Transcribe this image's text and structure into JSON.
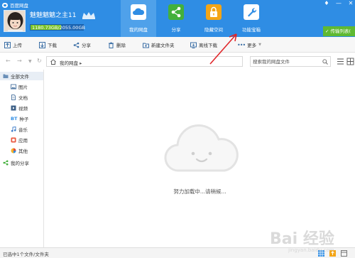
{
  "app": {
    "title": "百度网盘"
  },
  "window_controls": [
    "♦",
    "—",
    "✕"
  ],
  "user": {
    "name": "魅魅魑魑之主11",
    "quota_text": "1180.73GB/2055.00GB",
    "quota_used_fraction": 0.575
  },
  "nav": {
    "items": [
      {
        "label": "我的网盘",
        "icon": "cloud-icon"
      },
      {
        "label": "分享",
        "icon": "share-icon"
      },
      {
        "label": "隐藏空间",
        "icon": "lock-icon"
      },
      {
        "label": "功能宝箱",
        "icon": "wrench-icon"
      }
    ],
    "active_index": 0
  },
  "transfer_button": "传输列表(",
  "toolbar": {
    "upload": "上传",
    "download": "下载",
    "share": "分享",
    "delete": "删除",
    "new_folder": "新建文件夹",
    "offline_download": "离线下载",
    "more": "更多"
  },
  "address": {
    "path": "我的网盘",
    "separator": "▸"
  },
  "search": {
    "placeholder": "搜索我的网盘文件"
  },
  "sidebar": {
    "items": [
      {
        "label": "全部文件",
        "icon": "folder-icon"
      },
      {
        "label": "图片",
        "icon": "image-icon"
      },
      {
        "label": "文档",
        "icon": "document-icon"
      },
      {
        "label": "视频",
        "icon": "video-icon"
      },
      {
        "label": "种子",
        "icon": "bt-icon",
        "icon_text": "BT"
      },
      {
        "label": "音乐",
        "icon": "music-icon"
      },
      {
        "label": "应用",
        "icon": "app-icon"
      },
      {
        "label": "其他",
        "icon": "other-icon"
      },
      {
        "label": "我的分享",
        "icon": "share-icon"
      }
    ]
  },
  "main": {
    "loading_text": "努力加载中...请稍候..."
  },
  "status": {
    "text": "已选中1个文件/文件夹"
  },
  "watermark": {
    "text": "Bai  经验",
    "subtext": "jingyan.baidu.com"
  },
  "colors": {
    "header": "#2f8de4",
    "nav_active": "#4fa1ea",
    "quota_fill": "#79c22a",
    "transfer": "#5fb932",
    "arrow": "#e0262a"
  }
}
